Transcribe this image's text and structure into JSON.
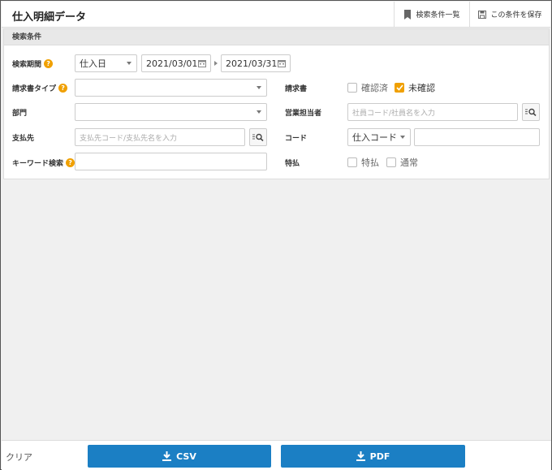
{
  "header": {
    "title": "仕入明細データ",
    "search_list_label": "検索条件一覧",
    "save_condition_label": "この条件を保存"
  },
  "search_panel": {
    "title": "検索条件",
    "period": {
      "label": "検索期間",
      "type_value": "仕入日",
      "date_from": "2021/03/01",
      "date_to": "2021/03/31"
    },
    "invoice_type": {
      "label": "請求書タイプ",
      "value": ""
    },
    "department": {
      "label": "部門",
      "value": ""
    },
    "supplier": {
      "label": "支払先",
      "placeholder": "支払先コード/支払先名を入力",
      "value": ""
    },
    "keyword": {
      "label": "キーワード検索",
      "value": ""
    },
    "invoice": {
      "label": "請求書",
      "options": [
        {
          "label": "確認済",
          "checked": false
        },
        {
          "label": "未確認",
          "checked": true
        }
      ]
    },
    "sales_person": {
      "label": "営業担当者",
      "placeholder": "社員コード/社員名を入力",
      "value": ""
    },
    "code": {
      "label": "コード",
      "type_value": "仕入コード",
      "value": ""
    },
    "special_payment": {
      "label": "特払",
      "options": [
        {
          "label": "特払",
          "checked": false
        },
        {
          "label": "通常",
          "checked": false
        }
      ]
    }
  },
  "footer": {
    "clear_label": "クリア",
    "csv_label": "CSV",
    "pdf_label": "PDF"
  },
  "colors": {
    "accent": "#1b7fc4",
    "help": "#f0a000",
    "checked": "#f0a000"
  }
}
